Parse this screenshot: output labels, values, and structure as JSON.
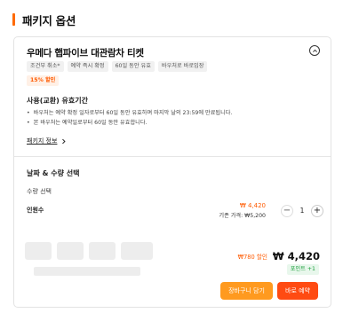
{
  "section": {
    "title": "패키지 옵션",
    "accent_color": "#ff6a00"
  },
  "product": {
    "title": "우메다 햅파이브 대관람차 티켓",
    "chips": [
      "조건부 취소*",
      "예약 즉시 확정",
      "60일 동안 유효",
      "바우처로 바로입장"
    ],
    "discount_badge": "15% 할인",
    "collapse_icon": "chevron-up-icon"
  },
  "validity": {
    "title": "사용(교환) 유효기간",
    "items": [
      "바우처는 예약 확정 일자로부터 60일 동안 유효하며 마지막 날의 23:59에 만료됩니다.",
      "본 바우처는 예약일로부터 60일 동안 유효합니다."
    ]
  },
  "package_info": {
    "label": "패키지 정보",
    "icon": "chevron-right-icon"
  },
  "selection": {
    "title": "날짜 & 수량 선택",
    "quantity_label": "수량 선택",
    "person_label": "인원수",
    "unit_price": "₩ 4,420",
    "base_price": "기존 가격: ₩5,200",
    "quantity": "1",
    "minus": "−",
    "plus": "+"
  },
  "total": {
    "discount": "₩780 할인",
    "amount": "₩ 4,420",
    "points": "포인트 +1"
  },
  "actions": {
    "cart": "장바구니 담기",
    "book": "바로 예약"
  },
  "colors": {
    "orange": "#ff5a00",
    "cart_button": "#ff9a1f",
    "book_button": "#ff4b12",
    "points_green": "#1a9e3a"
  }
}
